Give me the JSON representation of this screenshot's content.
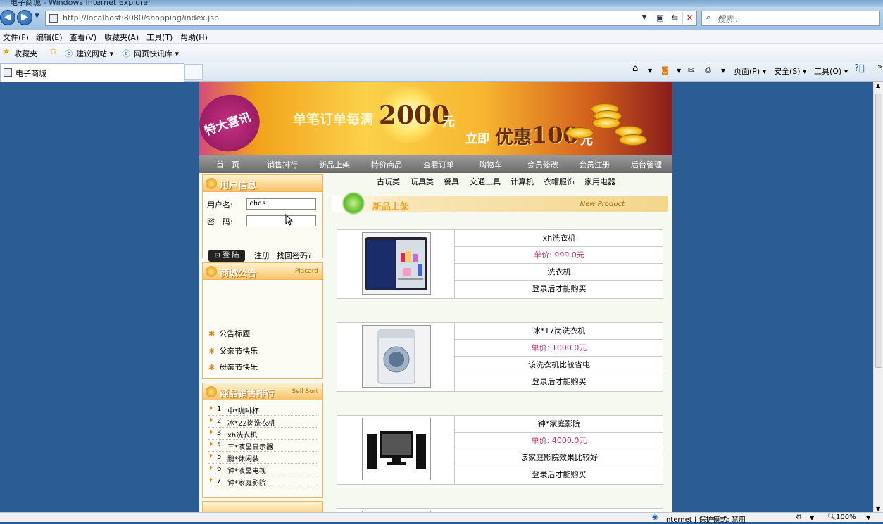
{
  "browser": {
    "window_title": "电子商城 - Windows Internet Explorer",
    "url": "http://localhost:8080/shopping/index.jsp",
    "search_placeholder": "搜索...",
    "menu": [
      "文件(F)",
      "编辑(E)",
      "查看(V)",
      "收藏夹(A)",
      "工具(T)",
      "帮助(H)"
    ],
    "favorites_label": "收藏夹",
    "fav_links": [
      "建议网站 ▾",
      "网页快讯库 ▾"
    ],
    "tab_title": "电子商城",
    "commands": [
      "页面(P) ▾",
      "安全(S) ▾",
      "工具(O) ▾"
    ],
    "status_zone": "Internet | 保护模式: 禁用",
    "zoom": "100%"
  },
  "banner": {
    "badge": "特大喜讯",
    "line1": "单笔订单每满",
    "amount": "2000",
    "unit1": "元",
    "line2a": "立即",
    "line2b": "优惠",
    "discount": "100",
    "unit2": "元"
  },
  "nav": [
    "首　页",
    "销售排行",
    "新品上架",
    "特价商品",
    "查看订单",
    "购物车",
    "会员修改",
    "会员注册",
    "后台管理"
  ],
  "user_info": {
    "title": "用户信息",
    "username_label": "用户名:",
    "username_value": "ches",
    "password_label": "密　码:",
    "login": "登 陆",
    "register": "注册",
    "forgot": "找回密码?"
  },
  "placard": {
    "title": "商城公告",
    "en": "Placard",
    "items": [
      "公告标题",
      "父亲节快乐",
      "母亲节快乐"
    ]
  },
  "sales_rank": {
    "title": "商品销售排行",
    "en": "Sell Sort",
    "items": [
      {
        "n": "1",
        "name": "中*咖啡杯"
      },
      {
        "n": "2",
        "name": "冰*22岗洗衣机"
      },
      {
        "n": "3",
        "name": "xh洗衣机"
      },
      {
        "n": "4",
        "name": "三*液晶显示器"
      },
      {
        "n": "5",
        "name": "鹏*休闲装"
      },
      {
        "n": "6",
        "name": "钟*液晶电视"
      },
      {
        "n": "7",
        "name": "钟*家庭影院"
      }
    ]
  },
  "categories": [
    "古玩类",
    "玩具类",
    "餐具",
    "交通工具",
    "计算机",
    "衣帽服饰",
    "家用电器"
  ],
  "new_products": {
    "title": "新品上架",
    "en": "New Product",
    "items": [
      {
        "name": "xh洗衣机",
        "price": "单价: 999.0元",
        "desc": "洗衣机",
        "action": "登录后才能购买"
      },
      {
        "name": "冰*17岗洗衣机",
        "price": "单价: 1000.0元",
        "desc": "该洗衣机比较省电",
        "action": "登录后才能购买"
      },
      {
        "name": "钟*家庭影院",
        "price": "单价: 4000.0元",
        "desc": "该家庭影院效果比较好",
        "action": "登录后才能购买"
      }
    ]
  }
}
